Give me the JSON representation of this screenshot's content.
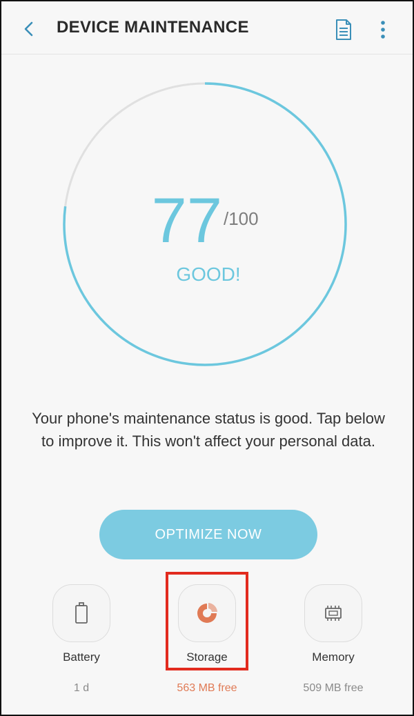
{
  "header": {
    "title": "DEVICE MAINTENANCE",
    "back_icon": "chevron-left-icon",
    "report_icon": "document-icon",
    "more_icon": "more-vertical-icon"
  },
  "score": {
    "value": "77",
    "max": "/100",
    "status": "GOOD!",
    "fraction": 0.77
  },
  "message": "Your phone's maintenance status is good. Tap below to improve it. This won't affect your personal data.",
  "optimize_button": {
    "label": "OPTIMIZE NOW"
  },
  "items": [
    {
      "label": "Battery",
      "value": "1 d",
      "icon": "battery-icon"
    },
    {
      "label": "Storage",
      "value": "563 MB free",
      "icon": "storage-pie-icon"
    },
    {
      "label": "Memory",
      "value": "509 MB free",
      "icon": "memory-chip-icon"
    }
  ],
  "colors": {
    "accent": "#6cc7de",
    "button": "#7ccbe1",
    "storage": "#e07a55",
    "highlight": "#e22b1e",
    "track": "#e0e0e0"
  }
}
